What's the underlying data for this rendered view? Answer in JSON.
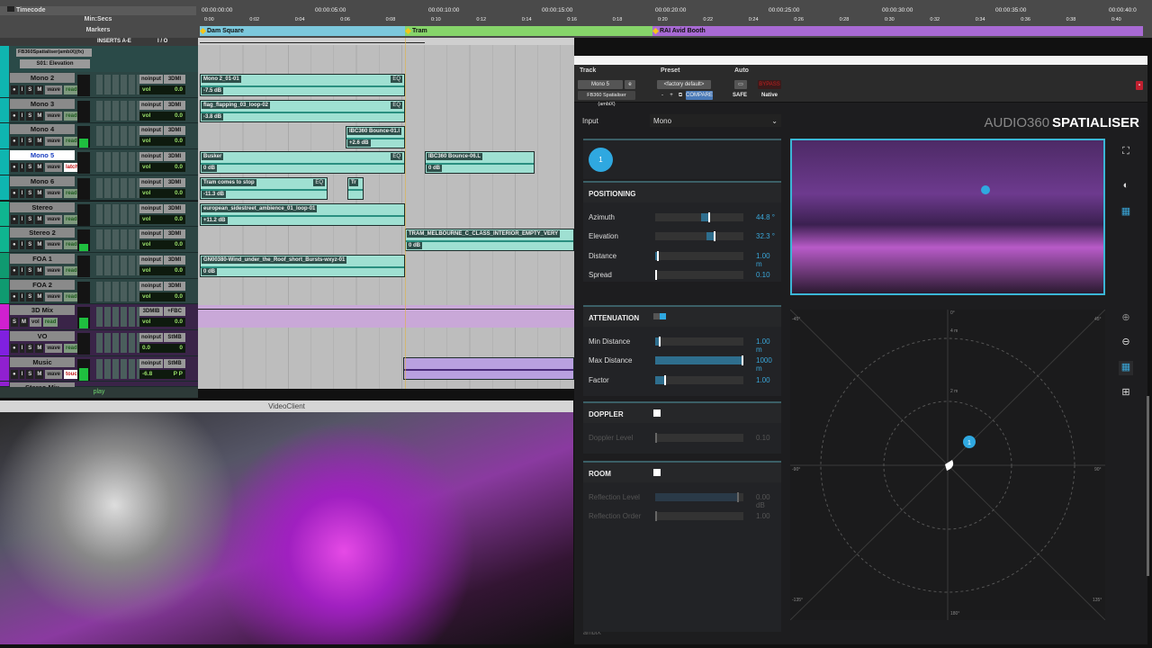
{
  "rulers": {
    "timecode_label": "Timecode",
    "minsecs_label": "Min:Secs",
    "markers_label": "Markers",
    "timecodes": [
      "00:00:00:00",
      "00:00:05:00",
      "00:00:10:00",
      "00:00:15:00",
      "00:00:20:00",
      "00:00:25:00",
      "00:00:30:00",
      "00:00:35:00",
      "00:00:40:0"
    ],
    "minsecs": [
      "0:00",
      "0:02",
      "0:04",
      "0:06",
      "0:08",
      "0:10",
      "0:12",
      "0:14",
      "0:16",
      "0:18",
      "0:20",
      "0:22",
      "0:24",
      "0:26",
      "0:28",
      "0:30",
      "0:32",
      "0:34",
      "0:36",
      "0:38",
      "0:40"
    ],
    "markers": [
      {
        "label": "Dam Square",
        "color": "#7cc8dc"
      },
      {
        "label": "Tram",
        "color": "#86d46a"
      },
      {
        "label": "RAI Avid Booth",
        "color": "#a86ad4"
      }
    ]
  },
  "header": {
    "inserts": "INSERTS A-E",
    "io": "I / O"
  },
  "automation": {
    "plugin": "FB360Spatialiser(ambiX)(fx)",
    "param": "S01: Elevation"
  },
  "tracks": [
    {
      "name": "Mono 2",
      "mode": "read",
      "in": "noinput",
      "out": "3DMI",
      "ctl": "vol",
      "val": "0.0"
    },
    {
      "name": "Mono 3",
      "mode": "read",
      "in": "noinput",
      "out": "3DMI",
      "ctl": "vol",
      "val": "0.0"
    },
    {
      "name": "Mono 4",
      "mode": "read",
      "in": "noinput",
      "out": "3DMI",
      "ctl": "vol",
      "val": "0.0"
    },
    {
      "name": "Mono 5",
      "mode": "latch",
      "in": "noinput",
      "out": "3DMI",
      "ctl": "vol",
      "val": "0.0"
    },
    {
      "name": "Mono 6",
      "mode": "read",
      "in": "noinput",
      "out": "3DMI",
      "ctl": "vol",
      "val": "0.0"
    },
    {
      "name": "Stereo",
      "mode": "read",
      "in": "noinput",
      "out": "3DMI",
      "ctl": "vol",
      "val": "0.0"
    },
    {
      "name": "Stereo 2",
      "mode": "read",
      "in": "noinput",
      "out": "3DMI",
      "ctl": "vol",
      "val": "0.0"
    },
    {
      "name": "FOA 1",
      "mode": "read",
      "in": "noinput",
      "out": "3DMI",
      "ctl": "vol",
      "val": "0.0"
    },
    {
      "name": "FOA 2",
      "mode": "read",
      "in": "noinput",
      "out": "3DMI",
      "ctl": "vol",
      "val": "0.0"
    },
    {
      "name": "3D Mix",
      "mode": "read",
      "in": "3DMIB",
      "out": "+FBC",
      "ctl": "vol",
      "val": "0.0"
    },
    {
      "name": "VO",
      "mode": "read",
      "in": "noinput",
      "out": "StMB",
      "ctl": "0.0",
      "val": "0"
    },
    {
      "name": "Music",
      "mode": "touch",
      "in": "noinput",
      "out": "StMB",
      "ctl": "-6.8",
      "val": "P P"
    },
    {
      "name": "Stereo Mix",
      "mode": "",
      "in": "",
      "out": "",
      "ctl": "",
      "val": ""
    }
  ],
  "track_buttons": {
    "wave": "wave",
    "vol": "vol",
    "i": "I",
    "s": "S",
    "m": "M"
  },
  "clips": [
    {
      "name": "Mono 2_01-01",
      "gain": "-7.5 dB",
      "eq": "EQ"
    },
    {
      "name": "flag_flapping_03_loop-02",
      "gain": "-3.8 dB",
      "eq": "EQ"
    },
    {
      "name": "IBC360 Bounce-01.l",
      "gain": "+2.6 dB"
    },
    {
      "name": "Busker",
      "gain": "0 dB",
      "eq": "EQ"
    },
    {
      "name": "IBC360 Bounce-06.L",
      "gain": "0 dB"
    },
    {
      "name": "Tram comes to stop",
      "gain": "-11.3 dB",
      "eq": "EQ"
    },
    {
      "name": "Tr"
    },
    {
      "name": "european_sidestreet_ambience_01_loop-01",
      "gain": "+11.2 dB"
    },
    {
      "name": "TRAM_MELBOURNE_C_CLASS_INTERIOR_EMPTY_VERY",
      "gain": "0 dB"
    },
    {
      "name": "GN00380-Wind_under_the_Roof_short_Bursts-wxyz-01",
      "gain": "0 dB"
    }
  ],
  "transport": {
    "status": "play"
  },
  "plugin": {
    "header": {
      "track_label": "Track",
      "preset_label": "Preset",
      "auto_label": "Auto",
      "track": "Mono 5",
      "track_sub": "e",
      "plugin": "FB360 Spatialiser (ambiX)",
      "preset": "<factory default>",
      "minus": "-",
      "plus": "+",
      "compare": "COMPARE",
      "safe": "SAFE",
      "native": "Native",
      "bypass": "BYPASS"
    },
    "input_label": "Input",
    "input_value": "Mono",
    "source_number": "1",
    "logo": {
      "light": "AUDIO360",
      "bold": "SPATIALISER"
    },
    "positioning": {
      "title": "POSITIONING",
      "rows": [
        {
          "label": "Azimuth",
          "value": "44.8 °",
          "pos": 0.61,
          "center": true
        },
        {
          "label": "Elevation",
          "value": "32.3 °",
          "pos": 0.68,
          "center": true
        },
        {
          "label": "Distance",
          "value": "1.00 m",
          "pos": 0.02
        },
        {
          "label": "Spread",
          "value": "0.10",
          "pos": 0.0
        }
      ]
    },
    "attenuation": {
      "title": "ATTENUATION",
      "enabled": true,
      "rows": [
        {
          "label": "Min Distance",
          "value": "1.00 m",
          "pos": 0.04
        },
        {
          "label": "Max Distance",
          "value": "1000 m",
          "pos": 1.0
        },
        {
          "label": "Factor",
          "value": "1.00",
          "pos": 0.1
        }
      ]
    },
    "doppler": {
      "title": "DOPPLER",
      "enabled": false,
      "rows": [
        {
          "label": "Doppler Level",
          "value": "0.10",
          "pos": 0.0
        }
      ]
    },
    "room": {
      "title": "ROOM",
      "enabled": false,
      "rows": [
        {
          "label": "Reflection Level",
          "value": "0.00 dB",
          "pos": 0.95
        },
        {
          "label": "Reflection Order",
          "value": "1.00",
          "pos": 0.0
        }
      ]
    },
    "radar": {
      "angles": {
        "top": "0°",
        "tl": "-45°",
        "tr": "45°",
        "l": "-90°",
        "r": "90°",
        "bl": "-135°",
        "br": "135°",
        "bottom": "180°"
      },
      "rings": [
        "4 m",
        "2 m"
      ]
    },
    "footer": "ambiX",
    "accent": "#3aa6d8"
  },
  "video_client": {
    "title": "VideoClient"
  }
}
